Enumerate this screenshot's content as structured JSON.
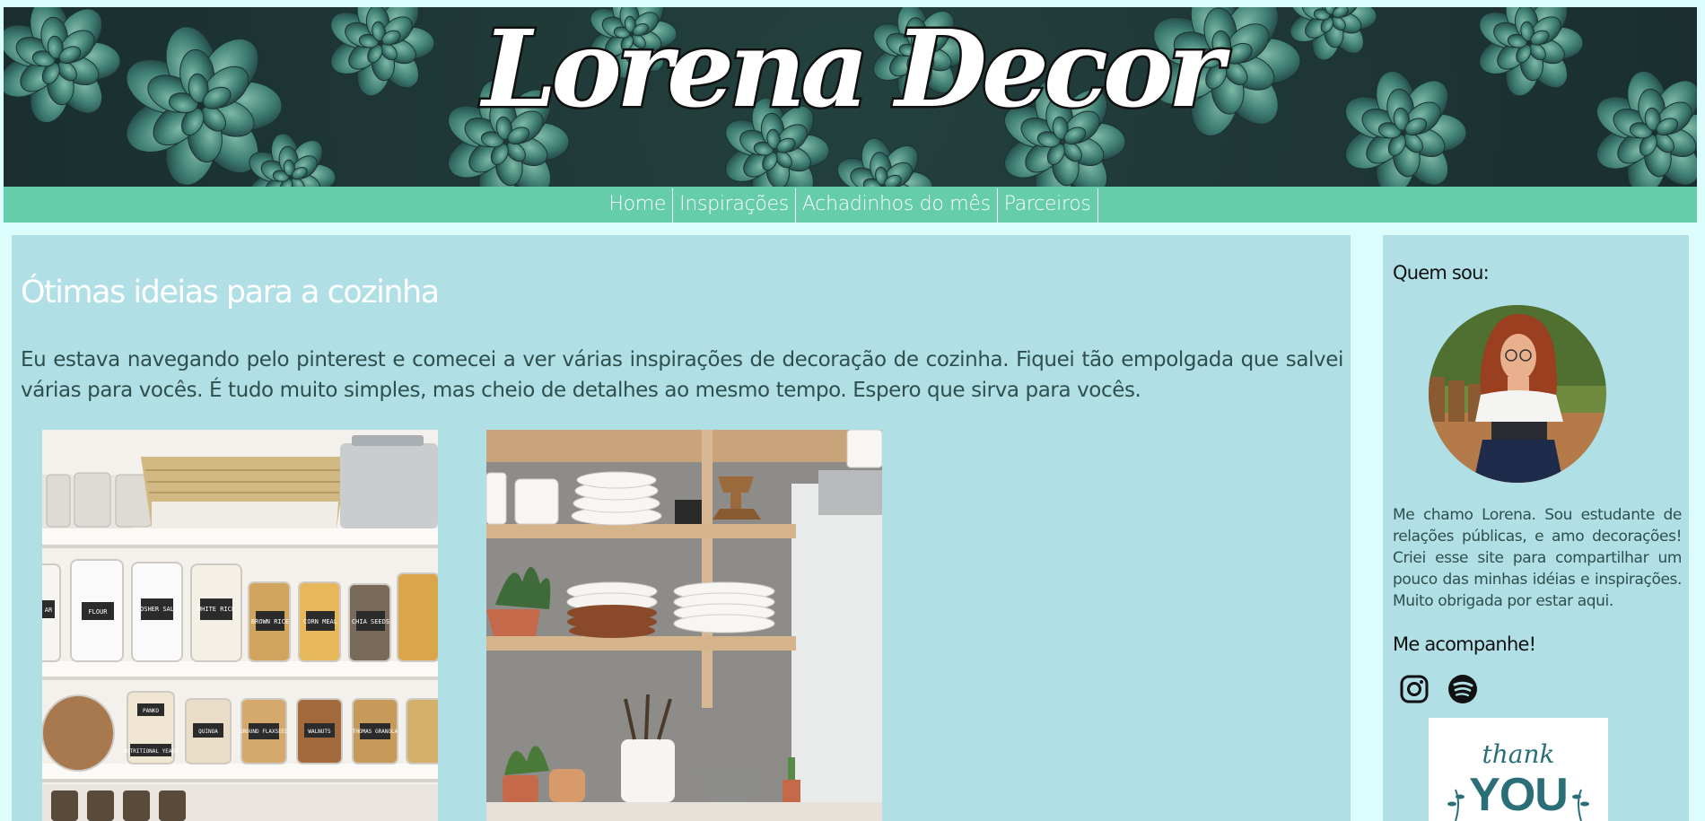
{
  "site": {
    "logo_text": "Lorena Decor"
  },
  "nav": {
    "items": [
      "Home",
      "Inspirações",
      "Achadinhos do mês",
      "Parceiros"
    ]
  },
  "post": {
    "title": "Ótimas ideias para a cozinha",
    "body": "Eu estava navegando pelo pinterest e comecei a ver várias inspirações de decoração de cozinha. Fiquei tão empolgada que salvei várias para vocês. É tudo muito simples, mas cheio de detalhes ao mesmo tempo. Espero que sirva para vocês.",
    "jar_labels": [
      "AR",
      "FLOUR",
      "KOSHER SALT",
      "WHITE RICE",
      "BROWN RICE",
      "CORN MEAL",
      "CHIA SEEDS",
      "PANKO",
      "QUINOA",
      "GROUND FLAXSEED",
      "WALNUTS",
      "THOMAS GRANOLA",
      "NUTRITIONAL YEAST"
    ]
  },
  "sidebar": {
    "about_heading": "Quem sou:",
    "bio": "Me chamo Lorena. Sou estudante de relações públicas, e amo decorações! Criei esse site para compartilhar um pouco das minhas idéias e inspirações. Muito obrigada por estar aqui.",
    "follow_heading": "Me acompanhe!",
    "social_icons": [
      "instagram-icon",
      "spotify-icon"
    ],
    "thanks_small": "thank",
    "thanks_big": "YOU"
  },
  "colors": {
    "background": "#ddfcfc",
    "nav": "#66cdaa",
    "panel": "#b0dfe5",
    "text": "#2f4f4f"
  }
}
